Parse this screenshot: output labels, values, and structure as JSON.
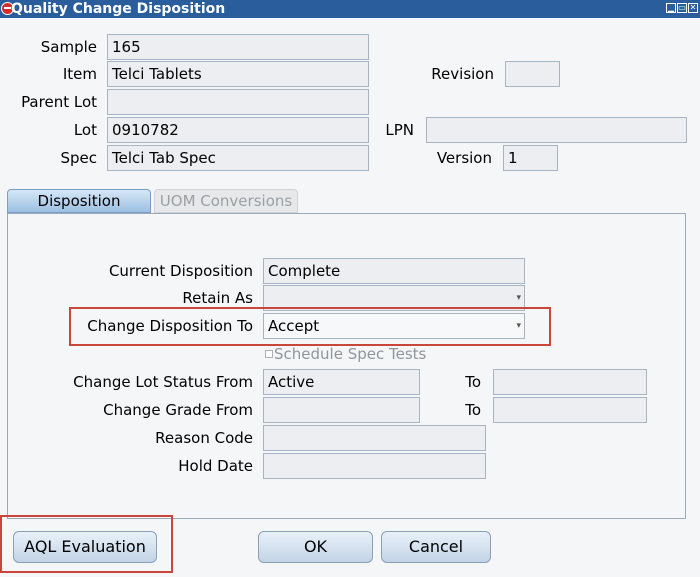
{
  "window": {
    "title": "Quality Change Disposition"
  },
  "header": {
    "sample_label": "Sample",
    "sample_value": "165",
    "item_label": "Item",
    "item_value": "Telci Tablets",
    "revision_label": "Revision",
    "revision_value": "",
    "parent_lot_label": "Parent Lot",
    "parent_lot_value": "",
    "lot_label": "Lot",
    "lot_value": "0910782",
    "lpn_label": "LPN",
    "lpn_value": "",
    "spec_label": "Spec",
    "spec_value": "Telci Tab Spec",
    "version_label": "Version",
    "version_value": "1"
  },
  "tabs": [
    {
      "label": "Disposition",
      "active": true
    },
    {
      "label": "UOM Conversions",
      "active": false
    }
  ],
  "disposition": {
    "current_label": "Current Disposition",
    "current_value": "Complete",
    "retain_label": "Retain As",
    "retain_value": "",
    "change_to_label": "Change Disposition To",
    "change_to_value": "Accept",
    "schedule_label": "Schedule Spec Tests",
    "schedule_checked": false,
    "lot_status_label": "Change Lot Status From",
    "lot_status_from": "Active",
    "to_label": "To",
    "lot_status_to": "",
    "grade_label": "Change Grade From",
    "grade_from": "",
    "grade_to": "",
    "reason_label": "Reason Code",
    "reason_value": "",
    "hold_label": "Hold Date",
    "hold_value": ""
  },
  "buttons": {
    "aql": "AQL Evaluation",
    "ok": "OK",
    "cancel": "Cancel"
  },
  "colors": {
    "titlebar": "#2a5d9b",
    "highlight": "#c9473a",
    "tab_active": "#9cc0e3"
  }
}
